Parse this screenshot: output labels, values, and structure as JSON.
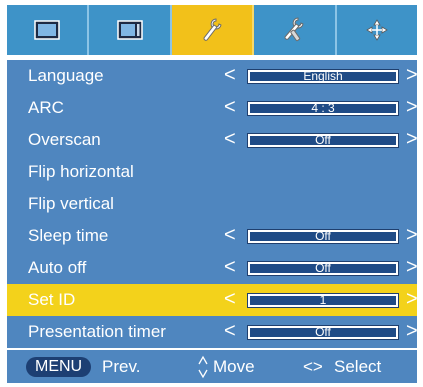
{
  "tabs": [
    {
      "icon": "picture-icon",
      "active": false
    },
    {
      "icon": "screen-icon",
      "active": false
    },
    {
      "icon": "wrench-icon",
      "active": true
    },
    {
      "icon": "tools-icon",
      "active": false
    },
    {
      "icon": "input-arrows-icon",
      "active": false
    }
  ],
  "menu": {
    "items": [
      {
        "label": "Language",
        "value": "English",
        "has_value": true,
        "selected": false
      },
      {
        "label": "ARC",
        "value": "4 : 3",
        "has_value": true,
        "selected": false
      },
      {
        "label": "Overscan",
        "value": "Off",
        "has_value": true,
        "selected": false
      },
      {
        "label": "Flip horizontal",
        "value": "",
        "has_value": false,
        "selected": false
      },
      {
        "label": "Flip vertical",
        "value": "",
        "has_value": false,
        "selected": false
      },
      {
        "label": "Sleep time",
        "value": "Off",
        "has_value": true,
        "selected": false
      },
      {
        "label": "Auto off",
        "value": "Off",
        "has_value": true,
        "selected": false
      },
      {
        "label": "Set ID",
        "value": "1",
        "has_value": true,
        "selected": true
      },
      {
        "label": "Presentation timer",
        "value": "Off",
        "has_value": true,
        "selected": false
      }
    ],
    "arrow_left": "<",
    "arrow_right": ">"
  },
  "footer": {
    "menu_key": "MENU",
    "prev_label": "Prev.",
    "move_label": "Move",
    "select_key": "<>",
    "select_label": "Select"
  },
  "colors": {
    "tab_bar": "#3e93c8",
    "tab_active": "#f2c11a",
    "menu_bg": "#4f86bf",
    "selected_row": "#f3d21b",
    "value_box": "#1f4b86"
  }
}
